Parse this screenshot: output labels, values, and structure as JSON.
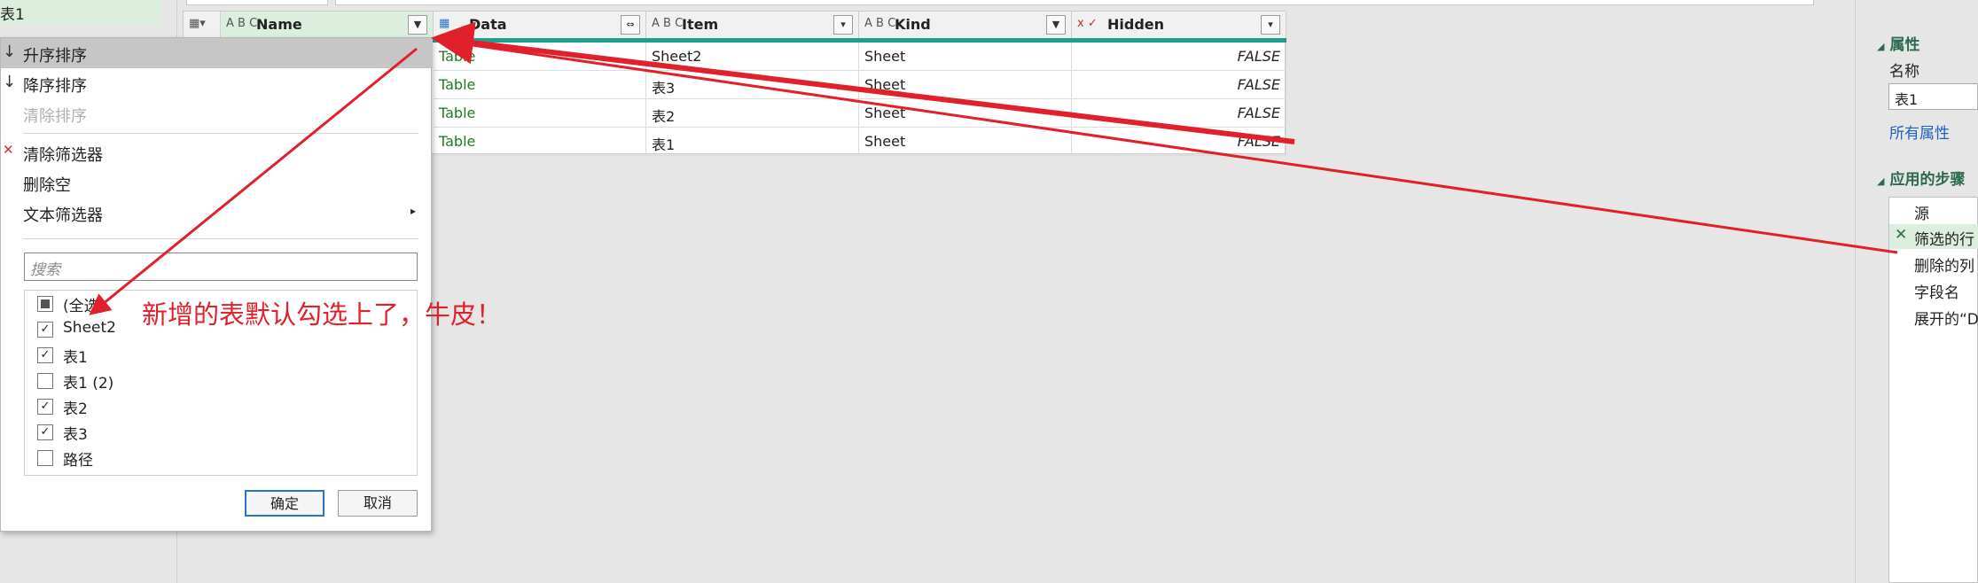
{
  "query_pane": {
    "selected_query": "表1"
  },
  "columns": [
    {
      "type_icon": "A B C",
      "name": "Name",
      "filter_icon": "filter-active-icon"
    },
    {
      "type_icon": "table",
      "name": "Data",
      "filter_icon": "expand-icon"
    },
    {
      "type_icon": "A B C",
      "name": "Item",
      "filter_icon": "dropdown-icon"
    },
    {
      "type_icon": "A B C",
      "name": "Kind",
      "filter_icon": "filter-active-icon"
    },
    {
      "type_icon": "x ✓",
      "name": "Hidden",
      "filter_icon": "dropdown-icon"
    }
  ],
  "rows": [
    {
      "data": "Table",
      "item": "Sheet2",
      "kind": "Sheet",
      "hidden": "FALSE"
    },
    {
      "data": "Table",
      "item": "表3",
      "kind": "Sheet",
      "hidden": "FALSE"
    },
    {
      "data": "Table",
      "item": "表2",
      "kind": "Sheet",
      "hidden": "FALSE"
    },
    {
      "data": "Table",
      "item": "表1",
      "kind": "Sheet",
      "hidden": "FALSE"
    }
  ],
  "dropdown": {
    "sort_asc": "升序排序",
    "sort_desc": "降序排序",
    "clear_sort": "清除排序",
    "clear_filter": "清除筛选器",
    "remove_empty": "删除空",
    "text_filters": "文本筛选器",
    "search_placeholder": "搜索",
    "items": [
      {
        "label": "(全选)",
        "state": "indeterminate"
      },
      {
        "label": "Sheet2",
        "state": "checked"
      },
      {
        "label": "表1",
        "state": "checked"
      },
      {
        "label": "表1 (2)",
        "state": "unchecked"
      },
      {
        "label": "表2",
        "state": "checked"
      },
      {
        "label": "表3",
        "state": "checked"
      },
      {
        "label": "路径",
        "state": "unchecked"
      }
    ],
    "ok": "确定",
    "cancel": "取消"
  },
  "annotation": "新增的表默认勾选上了，牛皮！",
  "settings": {
    "properties_title": "属性",
    "name_label": "名称",
    "name_value": "表1",
    "all_properties": "所有属性",
    "applied_steps_title": "应用的步骤",
    "steps": [
      "源",
      "筛选的行",
      "删除的列",
      "字段名",
      "展开的“D"
    ]
  },
  "colors": {
    "accent_teal": "#1fa08c",
    "annotation_red": "#e0202a",
    "selected_green": "#dcefdf"
  }
}
